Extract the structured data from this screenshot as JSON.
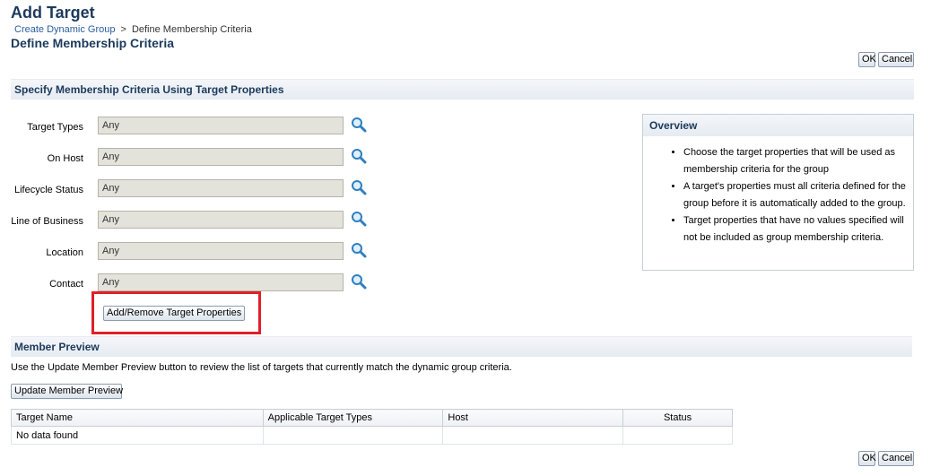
{
  "header": {
    "title": "Add Target",
    "breadcrumb": {
      "link": "Create Dynamic Group",
      "separator": ">",
      "current": "Define Membership Criteria"
    },
    "subtitle": "Define Membership Criteria"
  },
  "actions": {
    "ok_label": "OK",
    "cancel_label": "Cancel"
  },
  "criteria": {
    "section_title": "Specify Membership Criteria Using Target Properties",
    "fields": [
      {
        "label": "Target Types",
        "value": "Any"
      },
      {
        "label": "On Host",
        "value": "Any"
      },
      {
        "label": "Lifecycle Status",
        "value": "Any"
      },
      {
        "label": "Line of Business",
        "value": "Any"
      },
      {
        "label": "Location",
        "value": "Any"
      },
      {
        "label": "Contact",
        "value": "Any"
      }
    ],
    "add_remove_label": "Add/Remove Target Properties"
  },
  "overview": {
    "title": "Overview",
    "items": [
      "Choose the target properties that will be used as membership criteria for the group",
      "A target's properties must all criteria defined for the group before it is automatically added to the group.",
      "Target properties that have no values specified will not be included as group membership criteria."
    ]
  },
  "preview": {
    "section_title": "Member Preview",
    "description": "Use the Update Member Preview button to review the list of targets that currently match the dynamic group criteria.",
    "update_label": "Update Member Preview",
    "columns": [
      "Target Name",
      "Applicable Target Types",
      "Host",
      "Status"
    ],
    "empty_text": "No data found"
  },
  "colors": {
    "highlight": "#e01f2a",
    "heading": "#1c3a5c",
    "link": "#2a5d9e"
  }
}
